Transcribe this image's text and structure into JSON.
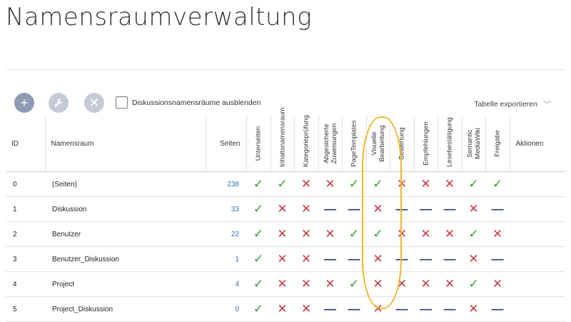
{
  "title": "Namensraumverwaltung",
  "toolbar": {
    "add_icon": "plus-icon",
    "edit_icon": "wrench-icon",
    "delete_icon": "close-icon",
    "hide_discussion_label": "Diskussionsnamensräume ausblenden",
    "hide_discussion_checked": false,
    "export_label": "Tabelle exportieren"
  },
  "columns": {
    "id": "ID",
    "name": "Namensraum",
    "pages": "Seiten",
    "features": [
      "Unterseiten",
      "Inhaltsnamensraum",
      "Kategorieprüfung",
      "Abgesicherte Zuweisungen",
      "PageTemplates",
      "Visuelle Bearbeitung",
      "Bewertung",
      "Empfehlungen",
      "Lesebestätigung",
      "Semantic MediaWiki",
      "Freigabe"
    ],
    "actions": "Aktionen"
  },
  "rows": [
    {
      "id": "0",
      "name": "(Seiten)",
      "pages": "238",
      "marks": [
        "yes",
        "yes",
        "no",
        "no",
        "yes",
        "yes",
        "no",
        "no",
        "no",
        "yes",
        "yes"
      ]
    },
    {
      "id": "1",
      "name": "Diskussion",
      "pages": "33",
      "marks": [
        "yes",
        "no",
        "no",
        "na",
        "na",
        "no",
        "na",
        "na",
        "na",
        "no",
        "na"
      ]
    },
    {
      "id": "2",
      "name": "Benutzer",
      "pages": "22",
      "marks": [
        "yes",
        "no",
        "no",
        "no",
        "yes",
        "yes",
        "no",
        "no",
        "no",
        "yes",
        "no"
      ]
    },
    {
      "id": "3",
      "name": "Benutzer_Diskussion",
      "pages": "1",
      "marks": [
        "yes",
        "no",
        "no",
        "na",
        "na",
        "no",
        "na",
        "na",
        "na",
        "no",
        "na"
      ]
    },
    {
      "id": "4",
      "name": "Project",
      "pages": "4",
      "marks": [
        "yes",
        "no",
        "no",
        "no",
        "yes",
        "no",
        "no",
        "no",
        "no",
        "yes",
        "no"
      ]
    },
    {
      "id": "5",
      "name": "Project_Diskussion",
      "pages": "0",
      "marks": [
        "yes",
        "no",
        "no",
        "na",
        "na",
        "no",
        "na",
        "na",
        "na",
        "no",
        "na"
      ]
    }
  ],
  "colors": {
    "yes": "#2e9e2e",
    "no": "#c93b3b",
    "na": "#2b3a6b",
    "highlight": "#f0b629"
  }
}
